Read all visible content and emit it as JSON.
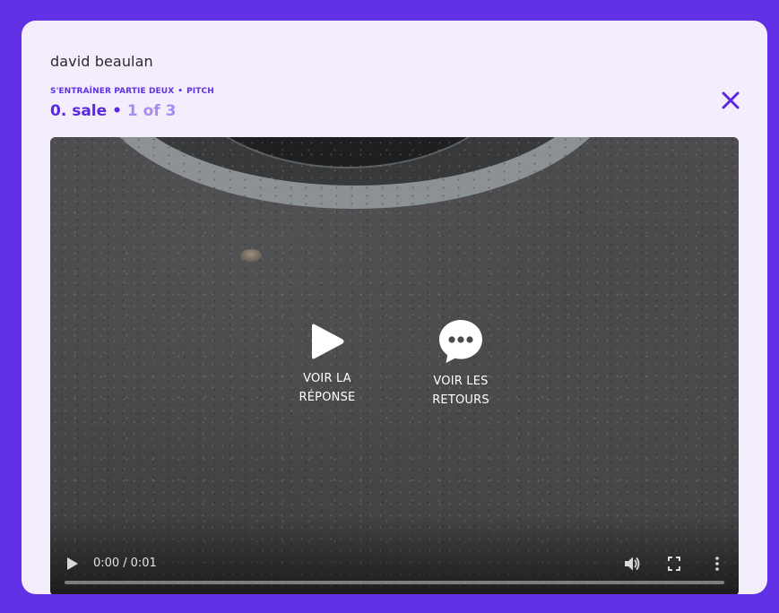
{
  "user": {
    "name": "david beaulan"
  },
  "breadcrumb": {
    "items": [
      "S'ENTRAÎNER PARTIE DEUX",
      "PITCH"
    ],
    "separator": "•"
  },
  "title": {
    "name": "0. sale",
    "separator": "•",
    "count": "1 of 3"
  },
  "actions": {
    "play": {
      "line1": "VOIR LA",
      "line2": "RÉPONSE"
    },
    "feedback": {
      "line1": "VOIR LES",
      "line2": "RETOURS"
    }
  },
  "video": {
    "current_time": "0:00",
    "separator": "/",
    "duration": "0:01",
    "progress": 0
  },
  "icons": {
    "close": "close-icon",
    "play": "play-icon",
    "feedback": "chat-bubble-icon",
    "video_play": "play-icon",
    "volume": "volume-icon",
    "fullscreen": "fullscreen-icon",
    "more": "more-vertical-icon"
  },
  "colors": {
    "frame": "#6231e6",
    "modal_bg": "#f4eefc",
    "accent": "#5a27e0",
    "count": "#a98cf0"
  }
}
